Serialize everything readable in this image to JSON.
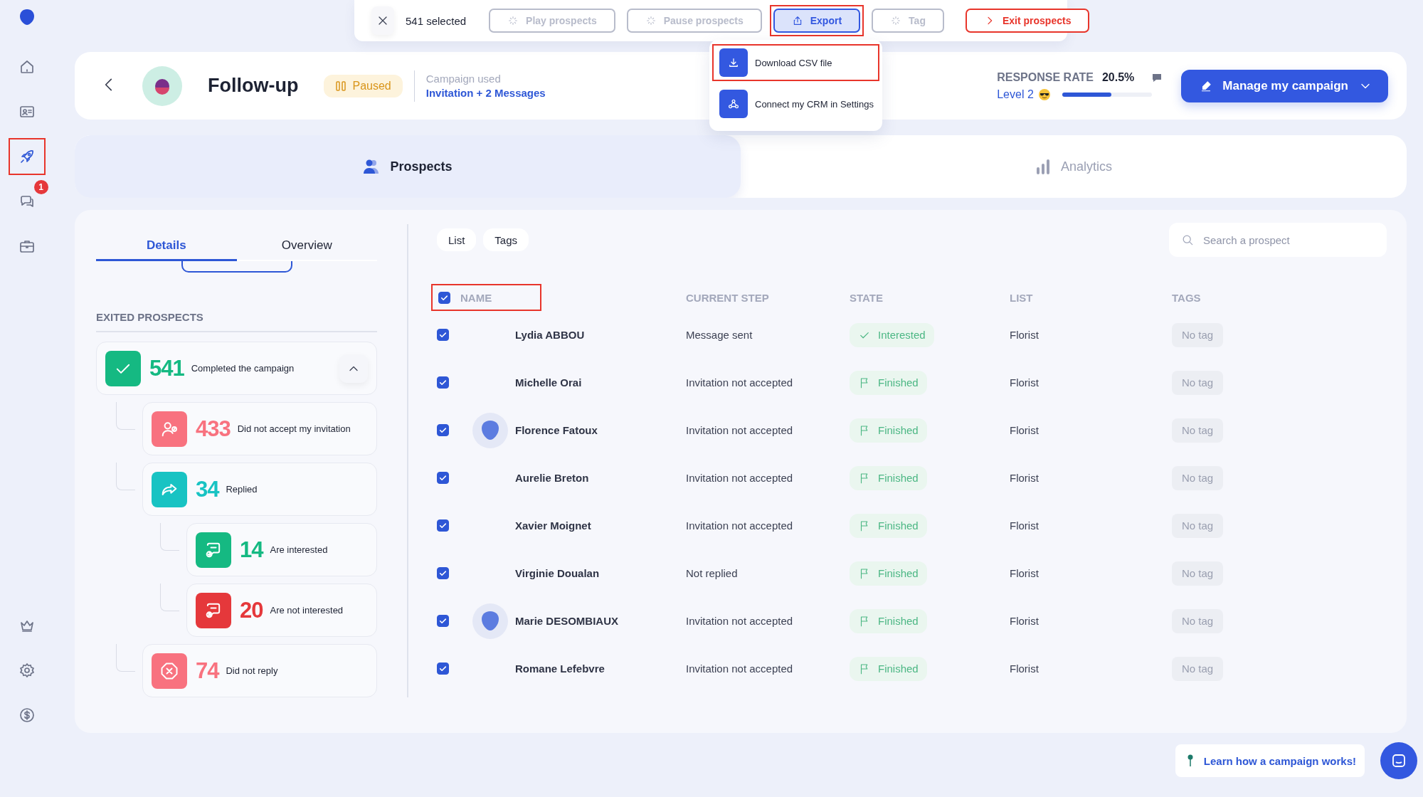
{
  "sidebar": {
    "items": [
      {
        "kind": "home",
        "selected": false,
        "highlighted": false
      },
      {
        "kind": "contact",
        "selected": false,
        "highlighted": false
      },
      {
        "kind": "rocket",
        "selected": true,
        "highlighted": true
      },
      {
        "kind": "chat",
        "selected": false,
        "highlighted": false,
        "badge": "1"
      },
      {
        "kind": "briefcase",
        "selected": false,
        "highlighted": false
      },
      {
        "kind": "crown",
        "selected": false,
        "highlighted": false
      },
      {
        "kind": "settings",
        "selected": false,
        "highlighted": false
      },
      {
        "kind": "dollar",
        "selected": false,
        "highlighted": false
      }
    ]
  },
  "action_bar": {
    "selected_count": "541 selected",
    "buttons": [
      {
        "label": "Play prospects",
        "kind": "spinner",
        "disabled": true,
        "highlighted": false
      },
      {
        "label": "Pause prospects",
        "kind": "spinner",
        "disabled": true,
        "highlighted": false
      },
      {
        "label": "Export",
        "kind": "export",
        "disabled": false,
        "highlighted": true
      },
      {
        "label": "Tag",
        "kind": "spinner",
        "disabled": true,
        "highlighted": false
      },
      {
        "label": "Exit prospects",
        "kind": "exit",
        "disabled": false,
        "highlighted": false
      }
    ]
  },
  "export_menu": {
    "items": [
      {
        "label": "Download CSV file",
        "kind": "download",
        "highlighted": true
      },
      {
        "label": "Connect my CRM in Settings",
        "kind": "crm",
        "highlighted": false
      }
    ]
  },
  "header": {
    "title": "Follow-up",
    "status": "Paused",
    "campaign_label": "Campaign used",
    "campaign_link": "Invitation + 2 Messages",
    "response_rate_label": "RESPONSE RATE",
    "response_rate": "20.5%",
    "level_label": "Level 2",
    "level": 0.55,
    "manage_button": "Manage my campaign"
  },
  "view_tabs": [
    {
      "label": "Prospects",
      "kind": "people",
      "selected": true
    },
    {
      "label": "Analytics",
      "kind": "chart",
      "selected": false
    }
  ],
  "details": {
    "tabs": [
      {
        "label": "Details",
        "selected": true
      },
      {
        "label": "Overview",
        "selected": false
      }
    ],
    "section_title": "EXITED PROSPECTS",
    "stats": [
      {
        "count": "541",
        "label": "Completed the campaign",
        "kind": "check",
        "color": "#15b982",
        "expanded": true,
        "children": [
          {
            "count": "433",
            "label": "Did not accept my invitation",
            "kind": "person",
            "color": "#f8727f"
          },
          {
            "count": "34",
            "label": "Replied",
            "kind": "reply",
            "color": "#18c3c3",
            "children": [
              {
                "count": "14",
                "label": "Are interested",
                "kind": "chat-check",
                "color": "#15b982"
              },
              {
                "count": "20",
                "label": "Are not interested",
                "kind": "chat-x",
                "color": "#e5383b"
              }
            ]
          },
          {
            "count": "74",
            "label": "Did not reply",
            "kind": "cross",
            "color": "#f8727f"
          }
        ]
      }
    ]
  },
  "table": {
    "filters": [
      "List",
      "Tags"
    ],
    "search": {
      "placeholder": "Search a prospect"
    },
    "header_checked": true,
    "header_highlighted": true,
    "columns": [
      "NAME",
      "CURRENT STEP",
      "STATE",
      "LIST",
      "TAGS"
    ],
    "rows": [
      {
        "checked": true,
        "avatar": false,
        "name": "Lydia ABBOU",
        "current_step": "Message sent",
        "state": "Interested",
        "interested": true,
        "list": "Florist",
        "tags": "No tag"
      },
      {
        "checked": true,
        "avatar": false,
        "name": "Michelle Orai",
        "current_step": "Invitation not accepted",
        "state": "Finished",
        "interested": false,
        "list": "Florist",
        "tags": "No tag"
      },
      {
        "checked": true,
        "avatar": true,
        "name": "Florence Fatoux",
        "current_step": "Invitation not accepted",
        "state": "Finished",
        "interested": false,
        "list": "Florist",
        "tags": "No tag"
      },
      {
        "checked": true,
        "avatar": false,
        "name": "Aurelie Breton",
        "current_step": "Invitation not accepted",
        "state": "Finished",
        "interested": false,
        "list": "Florist",
        "tags": "No tag"
      },
      {
        "checked": true,
        "avatar": false,
        "name": "Xavier Moignet",
        "current_step": "Invitation not accepted",
        "state": "Finished",
        "interested": false,
        "list": "Florist",
        "tags": "No tag"
      },
      {
        "checked": true,
        "avatar": false,
        "name": "Virginie Doualan",
        "current_step": "Not replied",
        "state": "Finished",
        "interested": false,
        "list": "Florist",
        "tags": "No tag"
      },
      {
        "checked": true,
        "avatar": true,
        "name": "Marie DESOMBIAUX",
        "current_step": "Invitation not accepted",
        "state": "Finished",
        "interested": false,
        "list": "Florist",
        "tags": "No tag"
      },
      {
        "checked": true,
        "avatar": false,
        "name": "Romane Lefebvre",
        "current_step": "Invitation not accepted",
        "state": "Finished",
        "interested": false,
        "list": "Florist",
        "tags": "No tag"
      }
    ]
  },
  "help_link": "Learn how a campaign works!"
}
